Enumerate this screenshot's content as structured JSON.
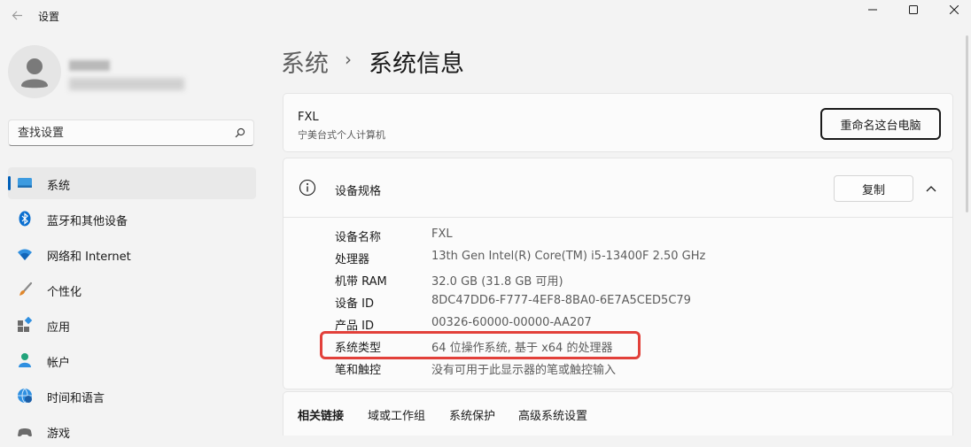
{
  "app": {
    "title": "设置"
  },
  "search": {
    "placeholder": "查找设置"
  },
  "sidebar": {
    "items": [
      {
        "label": "系统",
        "active": true
      },
      {
        "label": "蓝牙和其他设备"
      },
      {
        "label": "网络和 Internet"
      },
      {
        "label": "个性化"
      },
      {
        "label": "应用"
      },
      {
        "label": "帐户"
      },
      {
        "label": "时间和语言"
      },
      {
        "label": "游戏"
      }
    ]
  },
  "breadcrumb": {
    "parent": "系统",
    "separator": "›",
    "current": "系统信息"
  },
  "device": {
    "name": "FXL",
    "type": "宁美台式个人计算机",
    "rename_label": "重命名这台电脑"
  },
  "specs": {
    "title": "设备规格",
    "copy_label": "复制",
    "rows": [
      {
        "label": "设备名称",
        "value": "FXL"
      },
      {
        "label": "处理器",
        "value": "13th Gen Intel(R) Core(TM) i5-13400F   2.50 GHz"
      },
      {
        "label": "机带 RAM",
        "value": "32.0 GB (31.8 GB 可用)"
      },
      {
        "label": "设备 ID",
        "value": "8DC47DD6-F777-4EF8-8BA0-6E7A5CED5C79"
      },
      {
        "label": "产品 ID",
        "value": "00326-60000-00000-AA207"
      },
      {
        "label": "系统类型",
        "value": "64 位操作系统, 基于 x64 的处理器"
      },
      {
        "label": "笔和触控",
        "value": "没有可用于此显示器的笔或触控输入"
      }
    ]
  },
  "related_links": {
    "title": "相关链接",
    "links": [
      "域或工作组",
      "系统保护",
      "高级系统设置"
    ]
  },
  "colors": {
    "accent": "#005fb8",
    "highlight": "#e2403a"
  }
}
